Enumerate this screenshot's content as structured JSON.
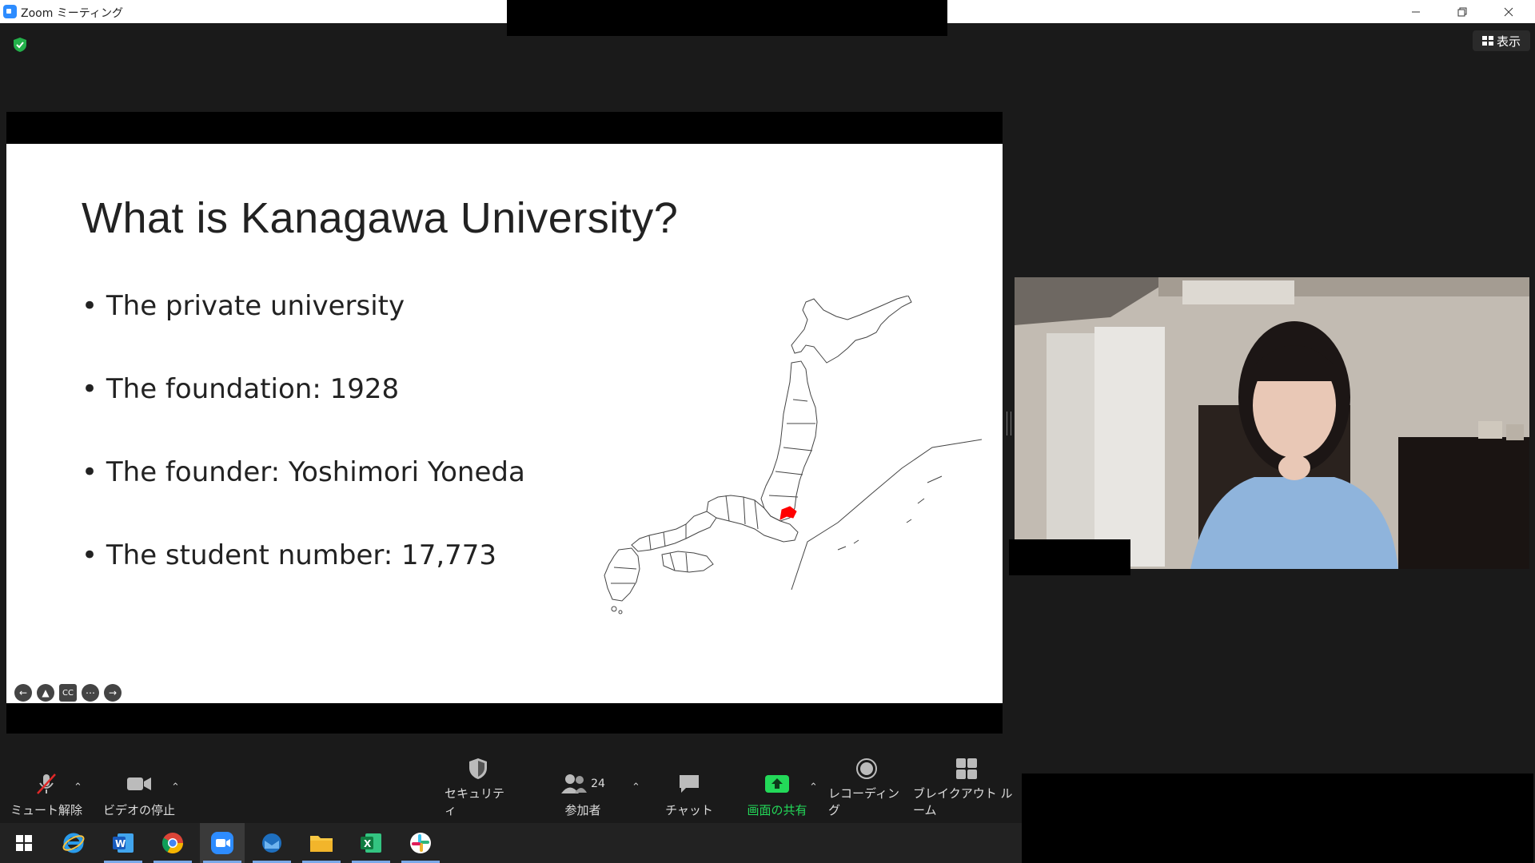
{
  "window": {
    "title": "Zoom ミーティング",
    "view_button": "表示"
  },
  "slide": {
    "title": "What is Kanagawa University?",
    "bullets": [
      "The private university",
      "The foundation: 1928",
      "The founder: Yoshimori Yoneda",
      "The student number: 17,773"
    ],
    "highlight_color": "#ff0000"
  },
  "toolbar": {
    "unmute_label": "ミュート解除",
    "video_label": "ビデオの停止",
    "security_label": "セキュリティ",
    "participants_label": "参加者",
    "participants_count": "24",
    "chat_label": "チャット",
    "share_label": "画面の共有",
    "recording_label": "レコーディング",
    "breakout_label": "ブレイクアウト ルーム",
    "share_color": "#23d959"
  },
  "taskbar": {
    "icons": [
      "windows-start-icon",
      "internet-explorer-icon",
      "word-icon",
      "chrome-icon",
      "zoom-icon",
      "outlook-icon",
      "file-explorer-icon",
      "excel-icon",
      "slack-icon"
    ]
  }
}
